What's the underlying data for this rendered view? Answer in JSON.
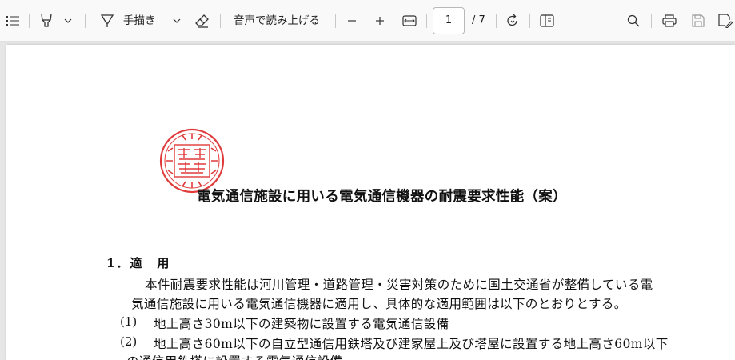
{
  "toolbar": {
    "draw_label": "手描き",
    "read_aloud_label": "音声で読み上げる",
    "page_current": "1",
    "page_total": "/ 7"
  },
  "icons": [
    "contents-list-icon",
    "highlight-icon",
    "chevron-down-icon",
    "draw-icon",
    "chevron-down-icon",
    "eraser-icon",
    "zoom-out-icon",
    "zoom-in-icon",
    "fit-page-icon",
    "rotate-icon",
    "page-view-icon",
    "search-icon",
    "print-icon",
    "save-icon",
    "save-as-icon"
  ],
  "document": {
    "title": "電気通信施設に用いる電気通信機器の耐震要求性能（案）",
    "section1_heading": "1．適　用",
    "section1_para_line1": "本件耐震要求性能は河川管理・道路管理・災害対策のために国土交通省が整備している電",
    "section1_para_line2": "気通信施設に用いる電気通信機器に適用し、具体的な適用範囲は以下のとおりとする。",
    "item1_num": "(1)",
    "item1_text": "地上高さ30m以下の建築物に設置する電気通信設備",
    "item2_num": "(2)",
    "item2_text": "地上高さ60m以下の自立型通信用鉄塔及び建家屋上及び塔屋に設置する地上高さ60m以下",
    "item2_text_cont": "の通信用鉄塔に設置する電気通信設備",
    "seal_color": "#e03a3a"
  }
}
